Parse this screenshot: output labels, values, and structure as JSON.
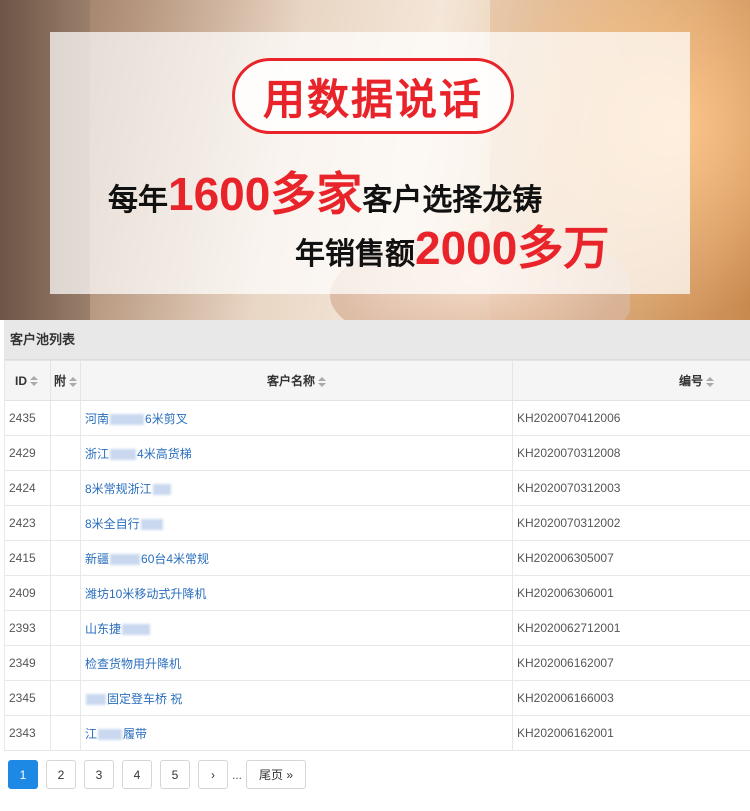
{
  "banner": {
    "slogan": "用数据说话",
    "line1": {
      "pre": "每年",
      "highlight": "1600多家",
      "post": "客户选择龙铸"
    },
    "line2": {
      "pre": "年销售额",
      "highlight": "2000多万"
    }
  },
  "table": {
    "title": "客户池列表",
    "columns": [
      "ID",
      "附",
      "客户名称",
      "编号"
    ],
    "rows": [
      {
        "id": "2435",
        "name_a": "河南",
        "name_b": "6米剪叉",
        "code": "KH2020070412006"
      },
      {
        "id": "2429",
        "name_a": "浙江",
        "name_b": "4米高货梯",
        "code": "KH2020070312008"
      },
      {
        "id": "2424",
        "name_a": "8米常规浙江",
        "name_b": "",
        "code": "KH2020070312003"
      },
      {
        "id": "2423",
        "name_a": "8米全自行",
        "name_b": "",
        "code": "KH2020070312002"
      },
      {
        "id": "2415",
        "name_a": "新疆",
        "name_b": "60台4米常规",
        "code": "KH202006305007"
      },
      {
        "id": "2409",
        "name_a": "潍坊10米移动式升降机",
        "name_b": "",
        "code": "KH202006306001"
      },
      {
        "id": "2393",
        "name_a": "山东捷",
        "name_b": "",
        "code": "KH202006271200​1"
      },
      {
        "id": "2349",
        "name_a": "检查货物用升降机",
        "name_b": "",
        "code": "KH202006162007"
      },
      {
        "id": "2345",
        "name_a": "",
        "name_b": "固定登车桥 祝",
        "code": "KH202006166003"
      },
      {
        "id": "2343",
        "name_a": "江",
        "name_b": "履带",
        "code": "KH202006162001"
      }
    ]
  },
  "pagination": {
    "pages": [
      "1",
      "2",
      "3",
      "4",
      "5"
    ],
    "active": "1",
    "next": "›",
    "ellipsis": "...",
    "last": "尾页 »"
  },
  "colors": {
    "accent_red": "#e8242a",
    "link_blue": "#2a6ebd",
    "active_blue": "#1e88e5"
  }
}
